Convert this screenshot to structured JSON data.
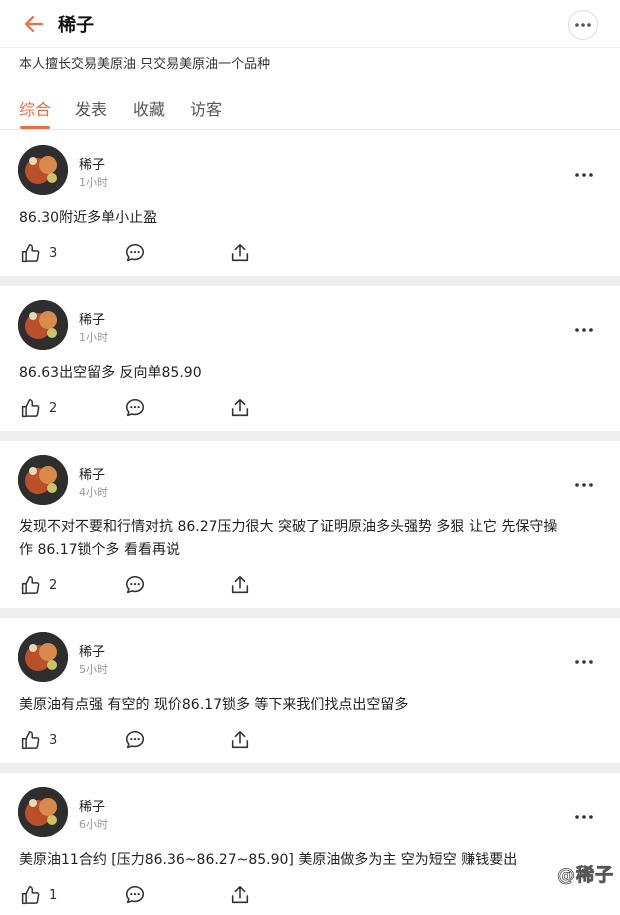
{
  "header": {
    "title": "稀子",
    "back_icon": "arrow-left-icon",
    "more_icon": "more-horizontal-icon",
    "accent": "#f26d3d"
  },
  "profile": {
    "bio": "本人擅长交易美原油 只交易美原油一个品种"
  },
  "tabs": [
    {
      "label": "综合",
      "active": true
    },
    {
      "label": "发表",
      "active": false
    },
    {
      "label": "收藏",
      "active": false
    },
    {
      "label": "访客",
      "active": false
    }
  ],
  "posts": [
    {
      "author": "稀子",
      "time": "1小时",
      "text": "86.30附近多单小止盈",
      "likes": "3"
    },
    {
      "author": "稀子",
      "time": "1小时",
      "text": "86.63出空留多 反向单85.90",
      "likes": "2"
    },
    {
      "author": "稀子",
      "time": "4小时",
      "text_lines": [
        "发现不对不要和行情对抗 86.27压力很大 突破了证明原油多头强势 多狠 让它 先保守操",
        "作 86.17锁个多 看看再说"
      ],
      "likes": "2"
    },
    {
      "author": "稀子",
      "time": "5小时",
      "text": "美原油有点强 有空的 现价86.17锁多 等下来我们找点出空留多",
      "likes": "3"
    },
    {
      "author": "稀子",
      "time": "6小时",
      "text": "美原油11合约 [压力86.36~86.27~85.90] 美原油做多为主 空为短空 赚钱要出",
      "likes": "1"
    }
  ],
  "watermark": "@稀子"
}
